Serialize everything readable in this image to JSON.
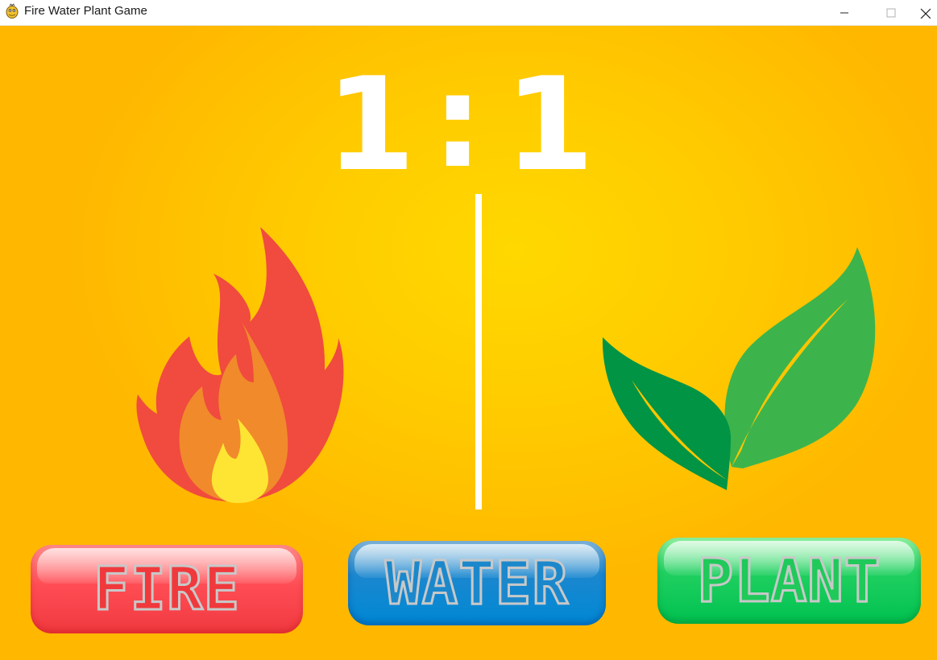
{
  "window": {
    "title": "Fire Water Plant Game",
    "icon": "pygame-snake-icon"
  },
  "scoreboard": {
    "player_score": "1",
    "separator": ":",
    "opponent_score": "1"
  },
  "arena": {
    "player_choice": "fire",
    "opponent_choice": "plant"
  },
  "choices": {
    "fire": "FIRE",
    "water": "WATER",
    "plant": "PLANT"
  },
  "colors": {
    "background": "#ffc800",
    "fire_button": "#ff4d55",
    "water_button": "#0088d4",
    "plant_button": "#00c150"
  }
}
